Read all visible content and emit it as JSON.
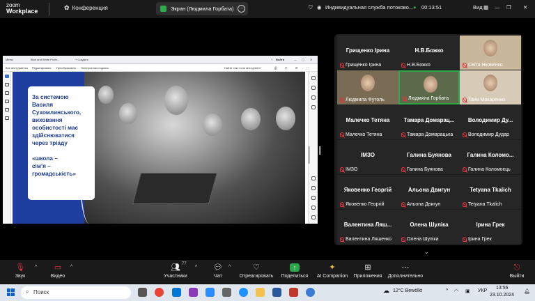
{
  "app": {
    "logo_line1": "zoom",
    "logo_line2": "Workplace",
    "conference_label": "Конференция",
    "screen_share_label": "Экран (Людмила Горбата)",
    "translation_label": "Индивидуальная служба потоково...",
    "timer": "00:13:51",
    "view_label": "Вид"
  },
  "pdf": {
    "tab1": "Меню",
    "tab2": "Blue and White Profe...",
    "tab3": "+ Создать",
    "signin": "Войти",
    "tools": [
      "Все инструменты",
      "Редактировать",
      "Преобразовать",
      "Электронная подпись"
    ],
    "find": "Найти текст или инструмент"
  },
  "slide": {
    "text_lines": [
      "За системою",
      "Василя",
      "Сухомлинського,",
      "виховання",
      "особистості має",
      "здійснюватися",
      "через тріаду",
      "",
      "«школа –",
      "сім’я –",
      "громадськість»"
    ]
  },
  "participants": [
    {
      "name": "Грищенко Ірина",
      "label": "Грищенко Ірина",
      "video": false
    },
    {
      "name": "Н.В.Божко",
      "label": "Н.В.Божко",
      "video": false
    },
    {
      "name": "",
      "label": "Світа Яковенко",
      "video": true
    },
    {
      "name": "",
      "label": "Людмила Футоль",
      "video": true
    },
    {
      "name": "",
      "label": "Людмила Горбата",
      "video": true
    },
    {
      "name": "",
      "label": "Таня Макаренко",
      "video": true
    },
    {
      "name": "Малечко Тетяна",
      "label": "Малечко Тетяна",
      "video": false
    },
    {
      "name": "Тамара Домарац...",
      "label": "Тамара Домарацька",
      "video": false
    },
    {
      "name": "Володимир Ду...",
      "label": "Володимир Дудар",
      "video": false
    },
    {
      "name": "ІМЗО",
      "label": "ІМЗО",
      "video": false
    },
    {
      "name": "Галина Буянова",
      "label": "Галина Буянова",
      "video": false
    },
    {
      "name": "Галина Коломо...",
      "label": "Галина Коломоєць",
      "video": false
    },
    {
      "name": "Яковенко Георгій",
      "label": "Яковенко Георгій",
      "video": false
    },
    {
      "name": "Альона Двигун",
      "label": "Альона Двигун",
      "video": false
    },
    {
      "name": "Tetyana Tkalich",
      "label": "Tetyana Tkalich",
      "video": false
    },
    {
      "name": "Валентина Ляш...",
      "label": "Валентина Ляшенко",
      "video": false
    },
    {
      "name": "Олена Шуліка",
      "label": "Олена Шуліка",
      "video": false
    },
    {
      "name": "Ірина Грек",
      "label": "Ірина Грек",
      "video": false
    }
  ],
  "toolbar": {
    "mute": "Звук",
    "video": "Видео",
    "participants": "Участники",
    "participants_count": "77",
    "chat": "Чат",
    "react": "Отреагировать",
    "share": "Поделиться",
    "ai": "AI Companion",
    "apps": "Приложения",
    "more": "Дополнительно",
    "leave": "Выйти"
  },
  "taskbar": {
    "search": "Поиск",
    "weather": "12°C  Bewölkt",
    "lang": "УКР",
    "time": "13:56",
    "date": "23.10.2024"
  },
  "colors": {
    "share_green": "#2ea84a",
    "leave_red": "#e0353d",
    "slide_blue": "#1f3fa0",
    "active_speaker": "#2ea84a"
  }
}
